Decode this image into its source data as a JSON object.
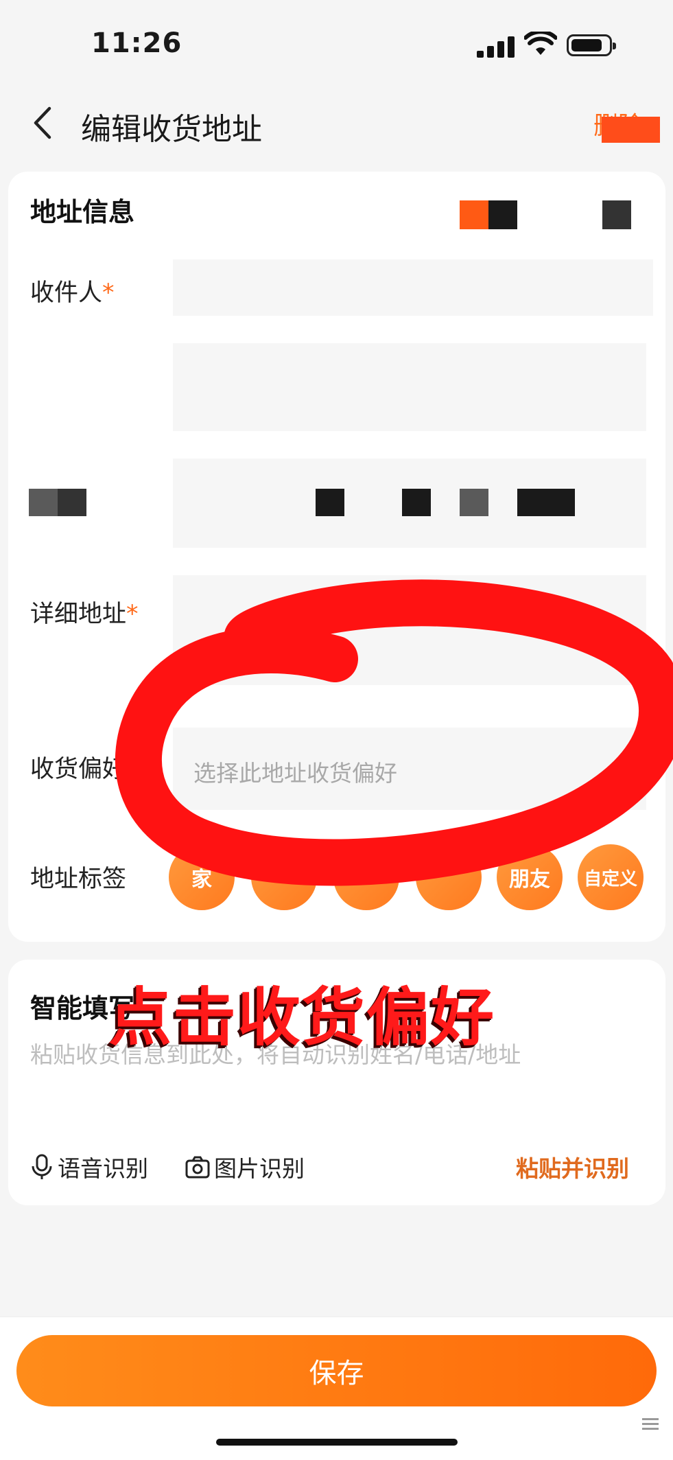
{
  "status_bar": {
    "time": "11:26"
  },
  "nav": {
    "title": "编辑收货地址",
    "delete_label": "删除"
  },
  "address_card": {
    "section_title": "地址信息",
    "recipient_label": "收件人",
    "detail_label": "详细地址",
    "required_mark": "*",
    "preference_label": "收货偏好",
    "preference_placeholder": "选择此地址收货偏好",
    "tag_label": "地址标签",
    "tags": [
      "家",
      "",
      "",
      "",
      "朋友",
      "自定义"
    ]
  },
  "smart_card": {
    "section_title": "智能填写",
    "placeholder": "粘贴收货信息到此处，将自动识别姓名/电话/地址",
    "voice_label": "语音识别",
    "image_label": "图片识别",
    "paste_label": "粘贴并识别"
  },
  "annotation": {
    "text": "点击收货偏好",
    "color": "#ff1a1a"
  },
  "footer": {
    "save_label": "保存"
  },
  "colors": {
    "accent": "#ff6a1a",
    "button_gradient_start": "#ff8c1a",
    "button_gradient_end": "#ff6a0a",
    "page_bg": "#f5f5f5"
  }
}
